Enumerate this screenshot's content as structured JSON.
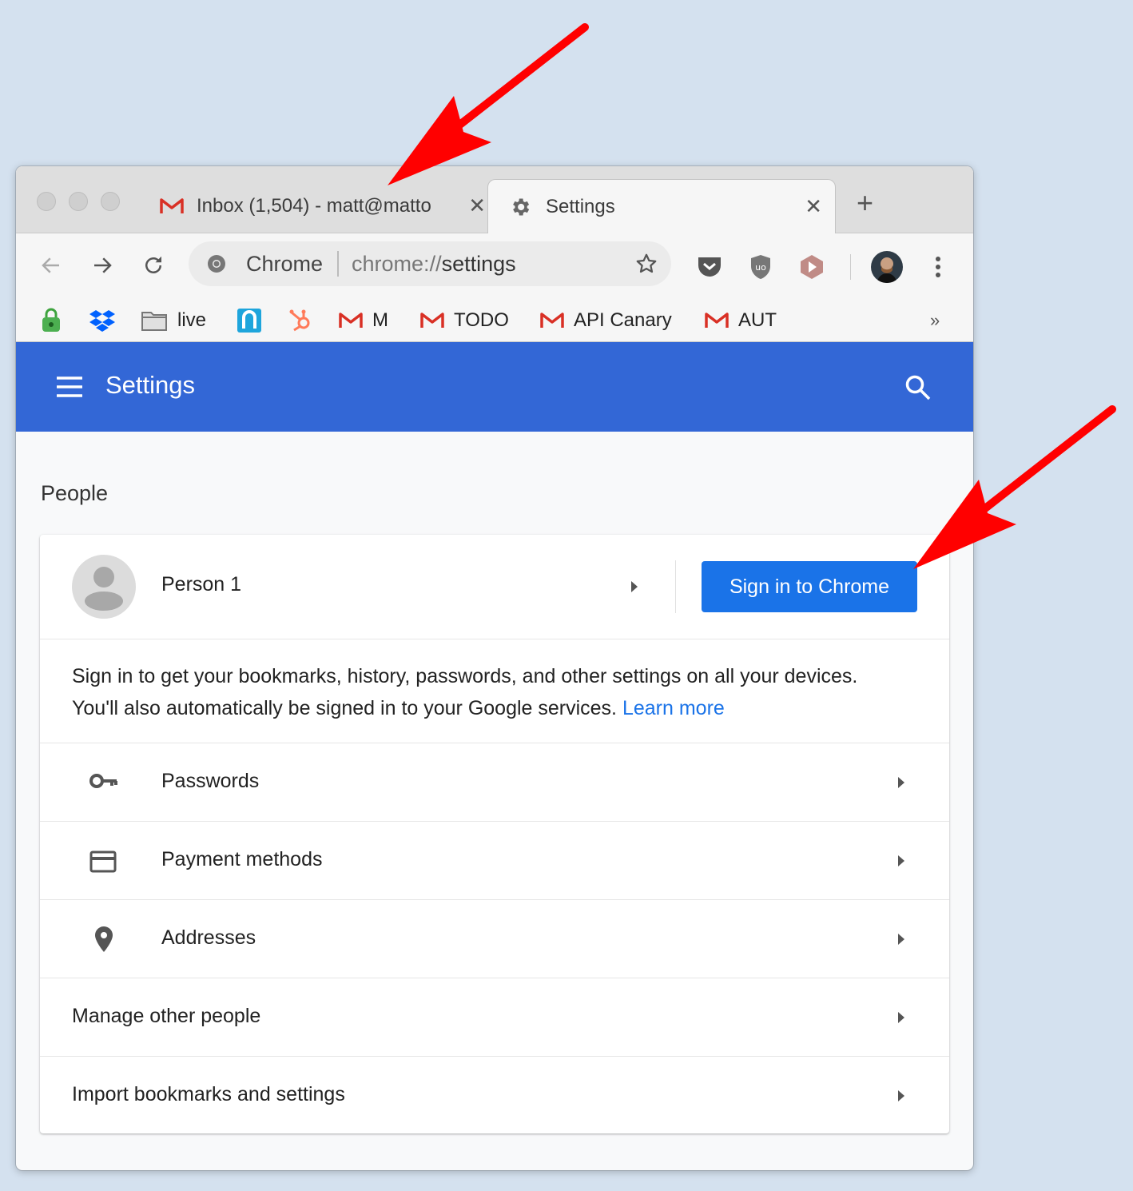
{
  "tabs": [
    {
      "label": "Inbox (1,504) - matt@matto",
      "icon": "gmail-icon",
      "close": "✕"
    },
    {
      "label": "Settings",
      "icon": "gear-icon",
      "close": "✕"
    }
  ],
  "new_tab": "+",
  "omnibox": {
    "host": "Chrome",
    "url_scheme": "chrome://",
    "url_path": "settings"
  },
  "bookmarks": [
    {
      "label": "",
      "icon": "lock-extension-icon"
    },
    {
      "label": "",
      "icon": "dropbox-icon"
    },
    {
      "label": "live",
      "icon": "folder-icon"
    },
    {
      "label": "",
      "icon": "n-app-icon"
    },
    {
      "label": "",
      "icon": "hubspot-icon"
    },
    {
      "label": "M",
      "icon": "gmail-icon"
    },
    {
      "label": "TODO",
      "icon": "gmail-icon"
    },
    {
      "label": "API Canary",
      "icon": "gmail-icon"
    },
    {
      "label": "AUT",
      "icon": "gmail-icon"
    }
  ],
  "bookmarks_overflow": "»",
  "header": {
    "title": "Settings"
  },
  "section_title": "People",
  "person": {
    "name": "Person 1",
    "signin_label": "Sign in to Chrome"
  },
  "description": {
    "line1": "Sign in to get your bookmarks, history, passwords, and other settings on all your devices.",
    "line2": "You'll also automatically be signed in to your Google services.",
    "link": "Learn more"
  },
  "rows": [
    {
      "label": "Passwords",
      "icon": "key-icon"
    },
    {
      "label": "Payment methods",
      "icon": "credit-card-icon"
    },
    {
      "label": "Addresses",
      "icon": "location-pin-icon"
    },
    {
      "label": "Manage other people",
      "icon": ""
    },
    {
      "label": "Import bookmarks and settings",
      "icon": ""
    }
  ],
  "colors": {
    "header_blue": "#3367d6",
    "button_blue": "#1a73e8",
    "annotation_red": "#ff0000",
    "page_background": "#d4e1ef"
  }
}
